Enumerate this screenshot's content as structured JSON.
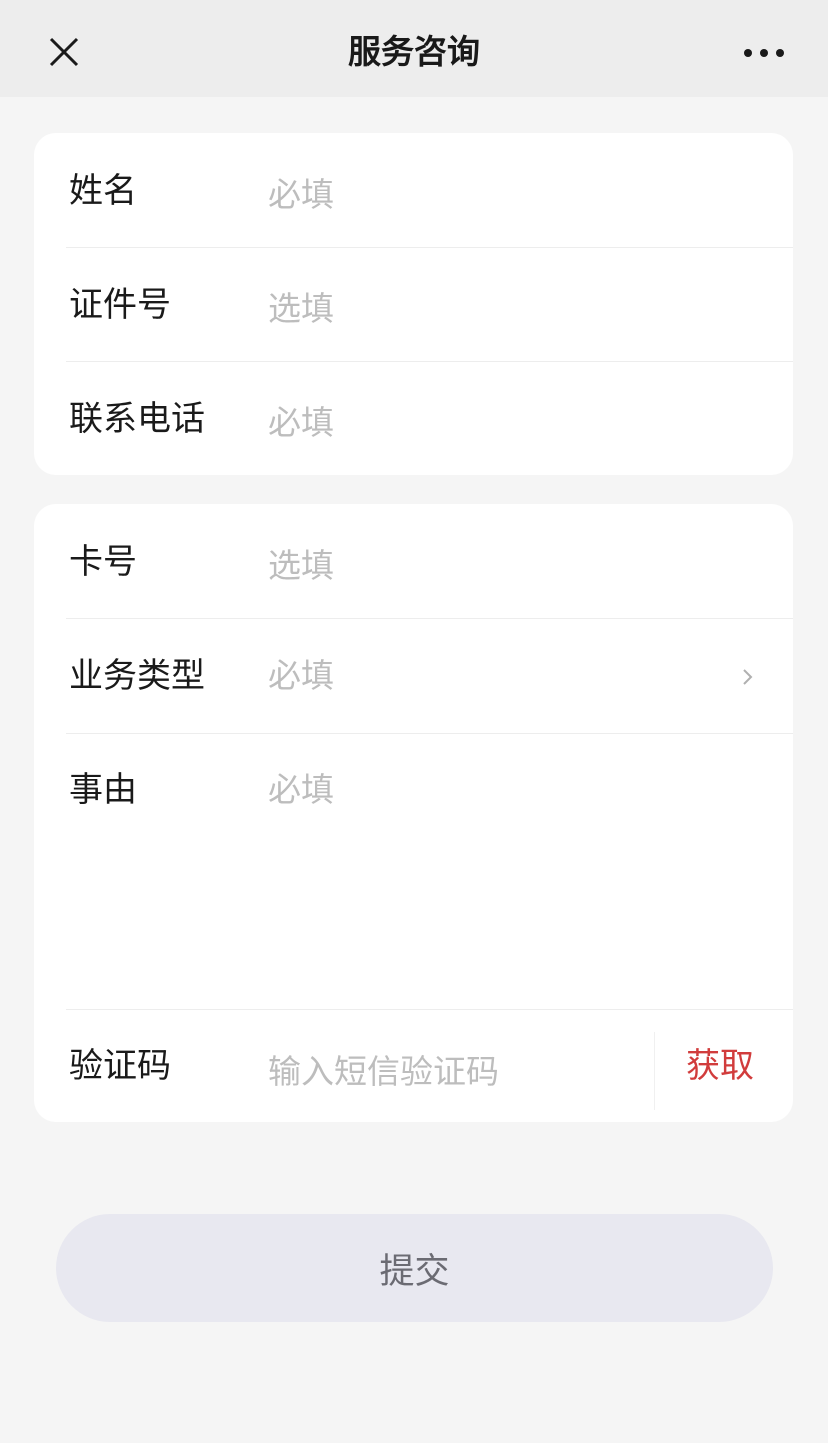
{
  "navbar": {
    "title": "服务咨询",
    "close_icon": "close-icon",
    "more_icon": "more-horizontal-icon"
  },
  "group1": {
    "fields": [
      {
        "label": "姓名",
        "placeholder": "必填",
        "value": ""
      },
      {
        "label": "证件号",
        "placeholder": "选填",
        "value": ""
      },
      {
        "label": "联系电话",
        "placeholder": "必填",
        "value": ""
      }
    ]
  },
  "group2": {
    "card_no": {
      "label": "卡号",
      "placeholder": "选填",
      "value": ""
    },
    "business_type": {
      "label": "业务类型",
      "placeholder": "必填",
      "value": "",
      "icon": "chevron-right-icon"
    },
    "reason": {
      "label": "事由",
      "placeholder": "必填",
      "value": ""
    },
    "sms_code": {
      "label": "验证码",
      "placeholder": "输入短信验证码",
      "value": "",
      "action_label": "获取"
    }
  },
  "submit": {
    "label": "提交"
  },
  "colors": {
    "accent_red": "#d13c3c",
    "placeholder": "#bdbdbd",
    "button_bg": "#e8e8f0"
  }
}
